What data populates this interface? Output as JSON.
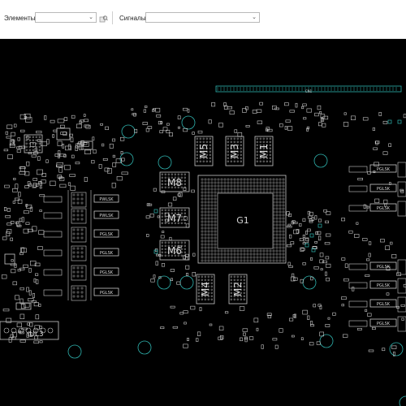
{
  "toolbar": {
    "elements_label": "Элементы:",
    "elements_value": "",
    "signals_label": "Сигналы:",
    "signals_value": "",
    "icons": {
      "find": "find-component-icon"
    }
  },
  "board": {
    "background": "#000000",
    "trace_color": "#c8c8c8",
    "highlight_color": "#2fb5b0",
    "gpu_label": "G1",
    "memory_labels": [
      "M8",
      "M7",
      "M6",
      "M5",
      "M3",
      "M1",
      "M4",
      "M2"
    ],
    "connector_label": "CN1",
    "vrm_labels_left": [
      "PWLSK",
      "PWLSK",
      "PGLSK",
      "PGLSK",
      "PGLSK",
      "PGLSK"
    ],
    "vrm_labels_right": [
      "PGLSK",
      "PGLSK",
      "PGLSK",
      "PGLSK",
      "PGLSK",
      "PGLSK",
      "PGLSK"
    ],
    "small_chip_label": "UL3"
  }
}
